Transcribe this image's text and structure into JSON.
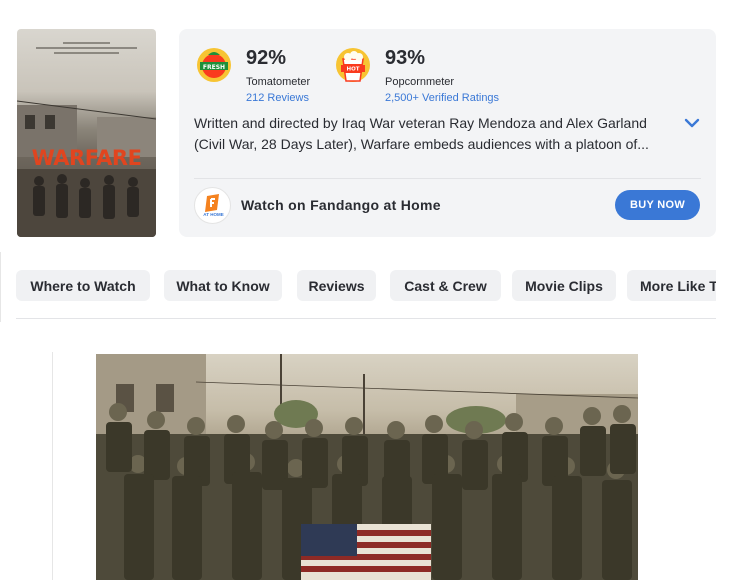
{
  "movie": {
    "poster_title": "WARFARE"
  },
  "scores": {
    "tomatometer": {
      "percent": "92%",
      "label": "Tomatometer",
      "reviews_link": "212 Reviews",
      "badge_icon": "certified-fresh-icon",
      "badge_text": "FRESH"
    },
    "popcornmeter": {
      "percent": "93%",
      "label": "Popcornmeter",
      "ratings_link": "2,500+ Verified Ratings",
      "badge_icon": "verified-hot-icon",
      "badge_text": "HOT"
    }
  },
  "synopsis": "Written and directed by Iraq War veteran Ray Mendoza and Alex Garland (Civil War, 28 Days Later), Warfare embeds audiences with a platoon of...",
  "watch": {
    "icon": "fandango-at-home-icon",
    "icon_text": "AT HOME",
    "label": "Watch on Fandango at Home",
    "buy_label": "BUY NOW"
  },
  "tabs": [
    {
      "label": "Where to Watch"
    },
    {
      "label": "What to Know"
    },
    {
      "label": "Reviews"
    },
    {
      "label": "Cast & Crew"
    },
    {
      "label": "Movie Clips"
    },
    {
      "label": "More Like This"
    }
  ],
  "colors": {
    "accent": "#3a78d6",
    "card_bg": "#f3f4f6",
    "poster_title": "#e0451f"
  }
}
